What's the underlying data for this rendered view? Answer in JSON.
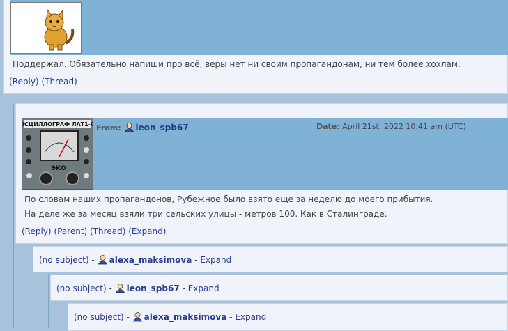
{
  "comment1": {
    "text": "Поддержал. Обязательно напиши про всё, веры нет ни своим пропагандонам, ни тем более хохлам.",
    "links": {
      "reply": "(Reply)",
      "thread": "(Thread)"
    }
  },
  "comment2": {
    "avatar_text": "ОСЦИЛЛОГРАФ ЛАТ1-С",
    "from_label": "From:",
    "user": "leon_spb67",
    "date_label": "Date:",
    "date_value": "April 21st, 2022 10:41 am (UTC)",
    "paragraphs": [
      "По словам наших пропагандонов, Рубежное было взято еще за неделю до моего прибытия.",
      "На деле же за месяц взяли три сельских улицы - метров 100. Как в Сталинграде."
    ],
    "links": {
      "reply": "(Reply)",
      "parent": "(Parent)",
      "thread": "(Thread)",
      "expand": "(Expand)"
    }
  },
  "collapsed": [
    {
      "subject": "(no subject)",
      "sep": "-",
      "user": "alexa_maksimova",
      "expand": "Expand"
    },
    {
      "subject": "(no subject)",
      "sep": "-",
      "user": "leon_spb67",
      "expand": "Expand"
    },
    {
      "subject": "(no subject)",
      "sep": "-",
      "user": "alexa_maksimova",
      "expand": "Expand"
    }
  ],
  "colors": {
    "header_bg": "#7fb2d5",
    "link": "#2a3a8c",
    "page_bg": "#a9c2db"
  },
  "icons": {
    "user": "user-icon"
  }
}
